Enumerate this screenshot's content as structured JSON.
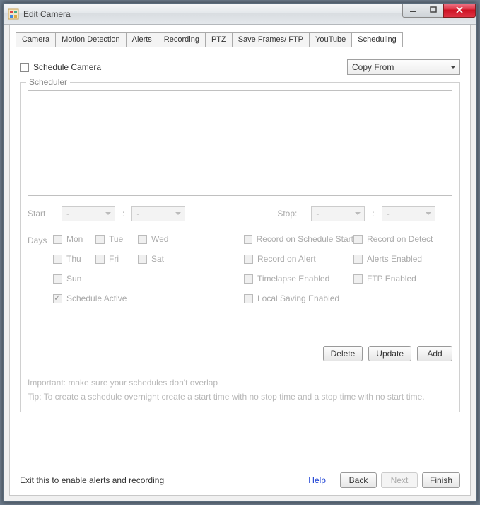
{
  "window": {
    "title": "Edit Camera"
  },
  "tabs": [
    "Camera",
    "Motion Detection",
    "Alerts",
    "Recording",
    "PTZ",
    "Save Frames/ FTP",
    "YouTube",
    "Scheduling"
  ],
  "active_tab": "Scheduling",
  "top": {
    "schedule_camera": "Schedule Camera",
    "copy_from": "Copy From"
  },
  "group": {
    "label": "Scheduler"
  },
  "time": {
    "start_label": "Start",
    "stop_label": "Stop:",
    "dash": "-"
  },
  "days": {
    "label": "Days",
    "mon": "Mon",
    "tue": "Tue",
    "wed": "Wed",
    "thu": "Thu",
    "fri": "Fri",
    "sat": "Sat",
    "sun": "Sun",
    "schedule_active": "Schedule Active"
  },
  "opts": {
    "rec_start": "Record on Schedule Start",
    "rec_detect": "Record on Detect",
    "rec_alert": "Record on Alert",
    "alerts_enabled": "Alerts Enabled",
    "timelapse": "Timelapse Enabled",
    "ftp": "FTP Enabled",
    "local_save": "Local Saving Enabled"
  },
  "buttons": {
    "delete": "Delete",
    "update": "Update",
    "add": "Add"
  },
  "notes": {
    "line1": "Important: make sure your schedules don't overlap",
    "line2": "Tip: To create a schedule overnight create a start time with no stop time and a stop time with no start time."
  },
  "footer": {
    "hint": "Exit this to enable alerts and recording",
    "help": "Help",
    "back": "Back",
    "next": "Next",
    "finish": "Finish"
  }
}
